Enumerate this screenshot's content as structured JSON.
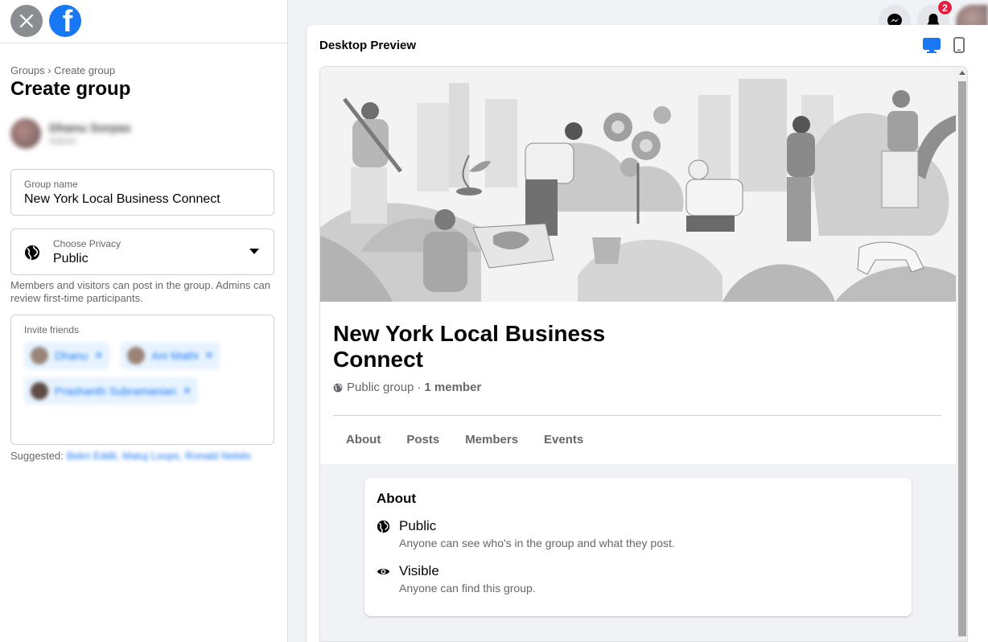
{
  "sidebar": {
    "breadcrumb": "Groups › Create group",
    "title": "Create group",
    "admin": {
      "name": "Dhanu Sorpas",
      "role": "Admin"
    },
    "group_name": {
      "label": "Group name",
      "value": "New York Local Business Connect"
    },
    "privacy": {
      "label": "Choose Privacy",
      "value": "Public",
      "help": "Members and visitors can post in the group. Admins can review first-time participants."
    },
    "invite": {
      "label": "Invite friends",
      "chips": [
        "Dhanu",
        "Ani Mathi",
        "Prashanth Subramanian"
      ]
    },
    "suggested": {
      "label": "Suggested:",
      "names": "Bekri Eddii, Matuj Loops, Ronald Nebits"
    }
  },
  "topbar": {
    "notification_count": "2"
  },
  "preview": {
    "title": "Desktop Preview",
    "group_title": "New York Local Business Connect",
    "meta_privacy": "Public group",
    "meta_members": "1 member",
    "tabs": [
      "About",
      "Posts",
      "Members",
      "Events"
    ],
    "about": {
      "title": "About",
      "items": [
        {
          "title": "Public",
          "desc": "Anyone can see who's in the group and what they post."
        },
        {
          "title": "Visible",
          "desc": "Anyone can find this group."
        }
      ]
    }
  },
  "colors": {
    "accent": "#1877f2",
    "badge": "#e41e3f",
    "text_secondary": "#65676b"
  },
  "icons": [
    "close-icon",
    "facebook-logo-icon",
    "globe-icon",
    "caret-down-icon",
    "messenger-icon",
    "bell-icon",
    "desktop-icon",
    "mobile-icon",
    "eye-icon"
  ]
}
